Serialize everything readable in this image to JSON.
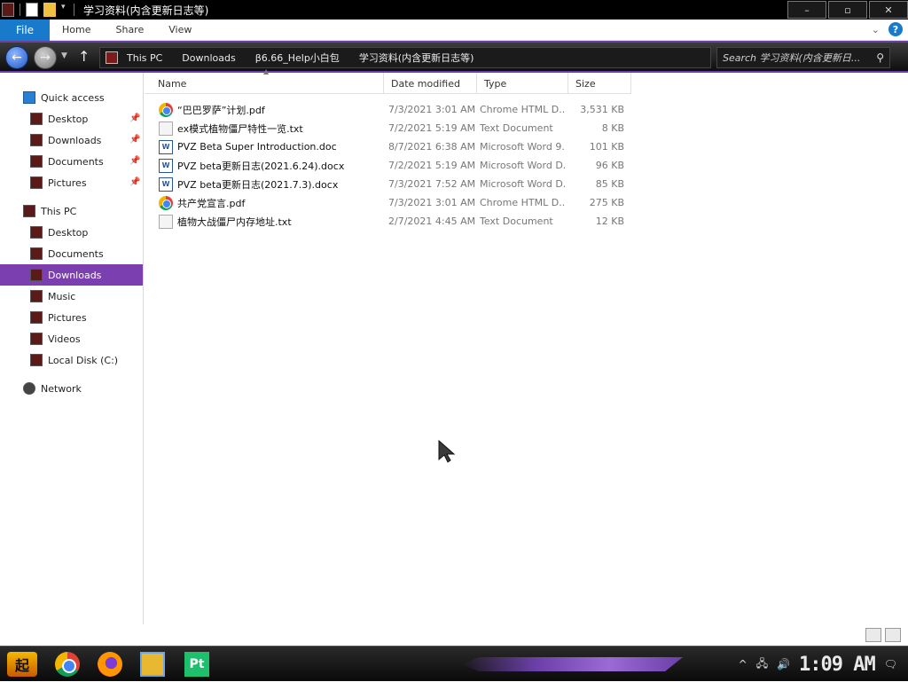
{
  "window": {
    "title": "学习资料(内含更新日志等)",
    "minimize": "–",
    "maximize": "▫",
    "close": "✕"
  },
  "ribbon": {
    "tabs": [
      "File",
      "Home",
      "Share",
      "View"
    ],
    "help": "?"
  },
  "address": {
    "breadcrumbs": [
      "This PC",
      "Downloads",
      "β6.66_Help小白包",
      "学习资料(内含更新日志等)"
    ],
    "search_placeholder": "Search 学习资料(内含更新日..."
  },
  "sidebar": {
    "items": [
      {
        "label": "Quick access",
        "icon": "star-icon",
        "level": 0
      },
      {
        "label": "Desktop",
        "icon": "folder-icon",
        "level": 1,
        "pinned": true
      },
      {
        "label": "Downloads",
        "icon": "folder-icon",
        "level": 1,
        "pinned": true
      },
      {
        "label": "Documents",
        "icon": "folder-icon",
        "level": 1,
        "pinned": true
      },
      {
        "label": "Pictures",
        "icon": "folder-icon",
        "level": 1,
        "pinned": true
      },
      {
        "label": "This PC",
        "icon": "computer-icon",
        "level": 0
      },
      {
        "label": "Desktop",
        "icon": "folder-icon",
        "level": 1
      },
      {
        "label": "Documents",
        "icon": "folder-icon",
        "level": 1
      },
      {
        "label": "Downloads",
        "icon": "folder-icon",
        "level": 1,
        "selected": true
      },
      {
        "label": "Music",
        "icon": "folder-icon",
        "level": 1
      },
      {
        "label": "Pictures",
        "icon": "folder-icon",
        "level": 1
      },
      {
        "label": "Videos",
        "icon": "folder-icon",
        "level": 1
      },
      {
        "label": "Local Disk (C:)",
        "icon": "drive-icon",
        "level": 1
      },
      {
        "label": "Network",
        "icon": "network-icon",
        "level": 0
      }
    ]
  },
  "columns": {
    "name": "Name",
    "date": "Date modified",
    "type": "Type",
    "size": "Size"
  },
  "files": [
    {
      "name": "“巴巴罗萨”计划.pdf",
      "date": "7/3/2021 3:01 AM",
      "type": "Chrome HTML D...",
      "size": "3,531 KB",
      "icon": "chrome-icon"
    },
    {
      "name": "ex模式植物僵尸特性一览.txt",
      "date": "7/2/2021 5:19 AM",
      "type": "Text Document",
      "size": "8 KB",
      "icon": "text-file-icon"
    },
    {
      "name": "PVZ Beta Super Introduction.doc",
      "date": "8/7/2021 6:38 AM",
      "type": "Microsoft Word 9...",
      "size": "101 KB",
      "icon": "word-icon"
    },
    {
      "name": "PVZ beta更新日志(2021.6.24).docx",
      "date": "7/2/2021 5:19 AM",
      "type": "Microsoft Word D...",
      "size": "96 KB",
      "icon": "word-icon"
    },
    {
      "name": "PVZ beta更新日志(2021.7.3).docx",
      "date": "7/3/2021 7:52 AM",
      "type": "Microsoft Word D...",
      "size": "85 KB",
      "icon": "word-icon"
    },
    {
      "name": "共产党宣言.pdf",
      "date": "7/3/2021 3:01 AM",
      "type": "Chrome HTML D...",
      "size": "275 KB",
      "icon": "chrome-icon"
    },
    {
      "name": "植物大战僵尸内存地址.txt",
      "date": "2/7/2021 4:45 AM",
      "type": "Text Document",
      "size": "12 KB",
      "icon": "text-file-icon"
    }
  ],
  "taskbar": {
    "start_label": "起",
    "apps": [
      "chrome-icon",
      "firefox-icon",
      "file-explorer-icon",
      "pt-app-icon"
    ],
    "pt_label": "Pt",
    "clock": "1:09 AM"
  },
  "theme": {
    "accent": "#7b3fb0",
    "file_tab": "#1979ca"
  }
}
